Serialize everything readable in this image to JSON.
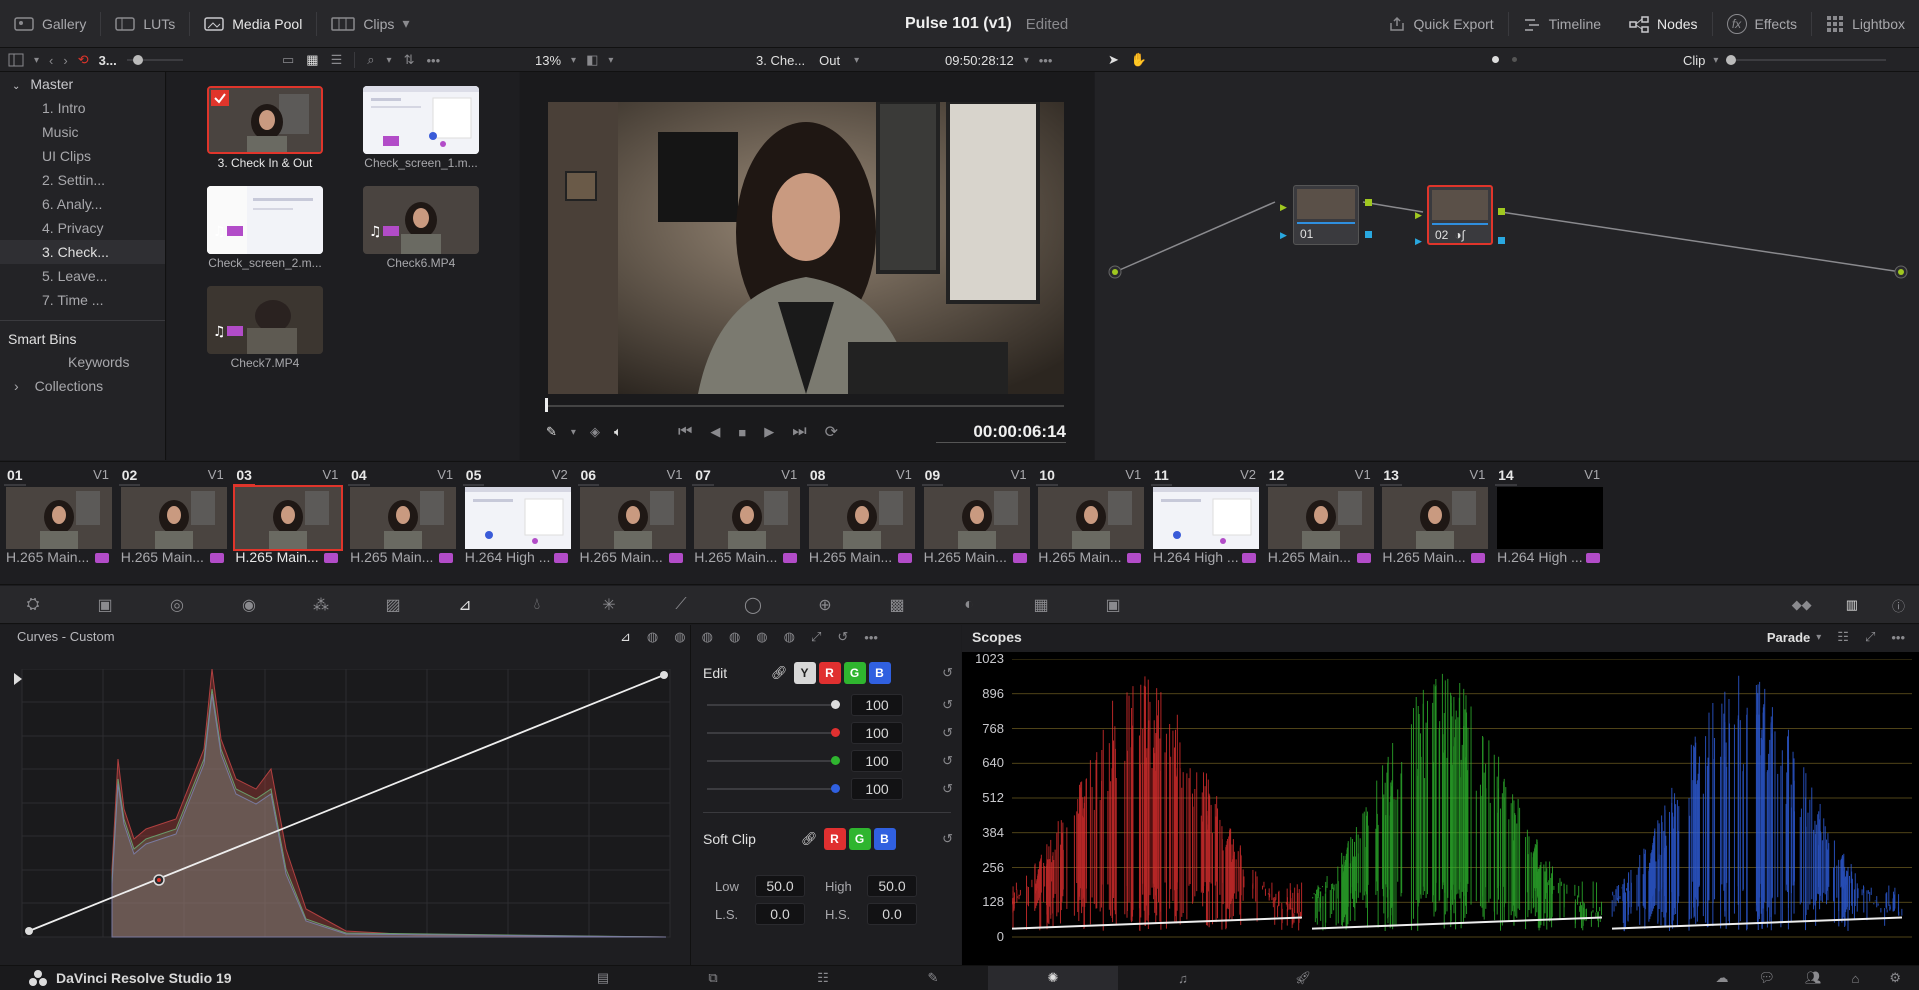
{
  "topbar": {
    "left": [
      {
        "label": "Gallery",
        "icon": "gallery-icon"
      },
      {
        "label": "LUTs",
        "icon": "luts-icon"
      },
      {
        "label": "Media Pool",
        "icon": "media-pool-icon"
      },
      {
        "label": "Clips",
        "icon": "clips-icon"
      }
    ],
    "project": "Pulse 101 (v1)",
    "status": "Edited",
    "right": [
      {
        "label": "Quick Export",
        "icon": "export-icon"
      },
      {
        "label": "Timeline",
        "icon": "timeline-icon"
      },
      {
        "label": "Nodes",
        "icon": "nodes-icon"
      },
      {
        "label": "Effects",
        "icon": "fx-icon"
      },
      {
        "label": "Lightbox",
        "icon": "lightbox-icon"
      }
    ]
  },
  "toolbar2": {
    "bin_short": "3...",
    "zoom": "13%",
    "clip_name": "3. Che...",
    "out_label": "Out",
    "timecode": "09:50:28:12",
    "node_mode": "Clip"
  },
  "bins": {
    "root": "Master",
    "items": [
      "1. Intro",
      "Music",
      "UI Clips",
      "2. Settin...",
      "6. Analy...",
      "4. Privacy",
      "3. Check...",
      "5. Leave...",
      "7. Time ..."
    ],
    "smart_title": "Smart Bins",
    "smart": [
      "Keywords",
      "Collections"
    ]
  },
  "media": [
    "3. Check In & Out",
    "Check_screen_1.m...",
    "Check_screen_2.m...",
    "Check6.MP4",
    "Check7.MP4"
  ],
  "viewer": {
    "timecode": "00:00:06:14"
  },
  "nodes": [
    {
      "label": "01"
    },
    {
      "label": "02"
    }
  ],
  "clips": [
    {
      "num": "01",
      "track": "V1",
      "codec": "H.265 Main..."
    },
    {
      "num": "02",
      "track": "V1",
      "codec": "H.265 Main..."
    },
    {
      "num": "03",
      "track": "V1",
      "codec": "H.265 Main..."
    },
    {
      "num": "04",
      "track": "V1",
      "codec": "H.265 Main..."
    },
    {
      "num": "05",
      "track": "V2",
      "codec": "H.264 High ..."
    },
    {
      "num": "06",
      "track": "V1",
      "codec": "H.265 Main..."
    },
    {
      "num": "07",
      "track": "V1",
      "codec": "H.265 Main..."
    },
    {
      "num": "08",
      "track": "V1",
      "codec": "H.265 Main..."
    },
    {
      "num": "09",
      "track": "V1",
      "codec": "H.265 Main..."
    },
    {
      "num": "10",
      "track": "V1",
      "codec": "H.265 Main..."
    },
    {
      "num": "11",
      "track": "V2",
      "codec": "H.264 High ..."
    },
    {
      "num": "12",
      "track": "V1",
      "codec": "H.265 Main..."
    },
    {
      "num": "13",
      "track": "V1",
      "codec": "H.265 Main..."
    },
    {
      "num": "14",
      "track": "V1",
      "codec": "H.264 High ..."
    }
  ],
  "curves": {
    "title": "Curves - Custom",
    "edit_label": "Edit",
    "channels": [
      "Y",
      "R",
      "G",
      "B"
    ],
    "intensity": [
      "100",
      "100",
      "100",
      "100"
    ],
    "softclip_label": "Soft Clip",
    "low_label": "Low",
    "low": "50.0",
    "high_label": "High",
    "high": "50.0",
    "ls_label": "L.S.",
    "ls": "0.0",
    "hs_label": "H.S.",
    "hs": "0.0"
  },
  "scopes": {
    "title": "Scopes",
    "mode": "Parade",
    "ticks": [
      "1023",
      "896",
      "768",
      "640",
      "512",
      "384",
      "256",
      "128",
      "0"
    ]
  },
  "status": {
    "app": "DaVinci Resolve Studio 19"
  },
  "colors": {
    "accent_red": "#e0352b",
    "r": "#e03030",
    "g": "#2fb52f",
    "b": "#3060e0"
  }
}
